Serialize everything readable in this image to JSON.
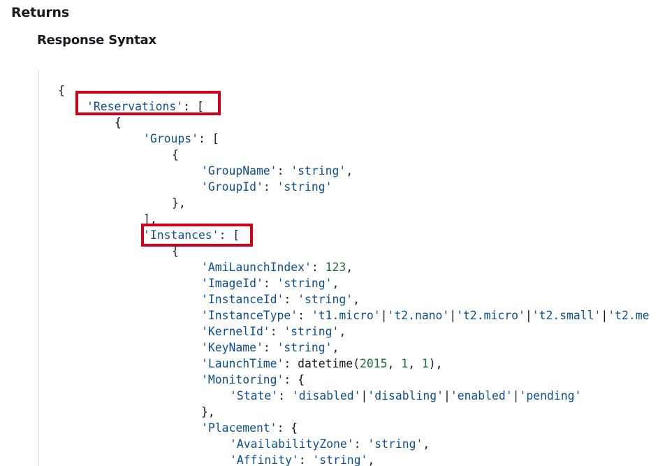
{
  "headings": {
    "returns": "Returns",
    "response_syntax": "Response Syntax"
  },
  "code_lines": [
    [
      {
        "t": "p",
        "v": "{"
      }
    ],
    [
      {
        "t": "s",
        "v": "'Reservations'"
      },
      {
        "t": "p",
        "v": ": ["
      }
    ],
    [
      {
        "t": "p",
        "v": "{"
      }
    ],
    [
      {
        "t": "s",
        "v": "'Groups'"
      },
      {
        "t": "p",
        "v": ": ["
      }
    ],
    [
      {
        "t": "p",
        "v": "{"
      }
    ],
    [
      {
        "t": "s",
        "v": "'GroupName'"
      },
      {
        "t": "p",
        "v": ": "
      },
      {
        "t": "s",
        "v": "'string'"
      },
      {
        "t": "p",
        "v": ","
      }
    ],
    [
      {
        "t": "s",
        "v": "'GroupId'"
      },
      {
        "t": "p",
        "v": ": "
      },
      {
        "t": "s",
        "v": "'string'"
      }
    ],
    [
      {
        "t": "p",
        "v": "},"
      }
    ],
    [
      {
        "t": "p",
        "v": "],"
      }
    ],
    [
      {
        "t": "s",
        "v": "'Instances'"
      },
      {
        "t": "p",
        "v": ": ["
      }
    ],
    [
      {
        "t": "p",
        "v": "{"
      }
    ],
    [
      {
        "t": "s",
        "v": "'AmiLaunchIndex'"
      },
      {
        "t": "p",
        "v": ": "
      },
      {
        "t": "n",
        "v": "123"
      },
      {
        "t": "p",
        "v": ","
      }
    ],
    [
      {
        "t": "s",
        "v": "'ImageId'"
      },
      {
        "t": "p",
        "v": ": "
      },
      {
        "t": "s",
        "v": "'string'"
      },
      {
        "t": "p",
        "v": ","
      }
    ],
    [
      {
        "t": "s",
        "v": "'InstanceId'"
      },
      {
        "t": "p",
        "v": ": "
      },
      {
        "t": "s",
        "v": "'string'"
      },
      {
        "t": "p",
        "v": ","
      }
    ],
    [
      {
        "t": "s",
        "v": "'InstanceType'"
      },
      {
        "t": "p",
        "v": ": "
      },
      {
        "t": "s",
        "v": "'t1.micro'"
      },
      {
        "t": "p",
        "v": "|"
      },
      {
        "t": "s",
        "v": "'t2.nano'"
      },
      {
        "t": "p",
        "v": "|"
      },
      {
        "t": "s",
        "v": "'t2.micro'"
      },
      {
        "t": "p",
        "v": "|"
      },
      {
        "t": "s",
        "v": "'t2.small'"
      },
      {
        "t": "p",
        "v": "|"
      },
      {
        "t": "s",
        "v": "'t2.me"
      }
    ],
    [
      {
        "t": "s",
        "v": "'KernelId'"
      },
      {
        "t": "p",
        "v": ": "
      },
      {
        "t": "s",
        "v": "'string'"
      },
      {
        "t": "p",
        "v": ","
      }
    ],
    [
      {
        "t": "s",
        "v": "'KeyName'"
      },
      {
        "t": "p",
        "v": ": "
      },
      {
        "t": "s",
        "v": "'string'"
      },
      {
        "t": "p",
        "v": ","
      }
    ],
    [
      {
        "t": "s",
        "v": "'LaunchTime'"
      },
      {
        "t": "p",
        "v": ": datetime("
      },
      {
        "t": "n",
        "v": "2015"
      },
      {
        "t": "p",
        "v": ", "
      },
      {
        "t": "n",
        "v": "1"
      },
      {
        "t": "p",
        "v": ", "
      },
      {
        "t": "n",
        "v": "1"
      },
      {
        "t": "p",
        "v": "),"
      }
    ],
    [
      {
        "t": "s",
        "v": "'Monitoring'"
      },
      {
        "t": "p",
        "v": ": {"
      }
    ],
    [
      {
        "t": "s",
        "v": "'State'"
      },
      {
        "t": "p",
        "v": ": "
      },
      {
        "t": "s",
        "v": "'disabled'"
      },
      {
        "t": "p",
        "v": "|"
      },
      {
        "t": "s",
        "v": "'disabling'"
      },
      {
        "t": "p",
        "v": "|"
      },
      {
        "t": "s",
        "v": "'enabled'"
      },
      {
        "t": "p",
        "v": "|"
      },
      {
        "t": "s",
        "v": "'pending'"
      }
    ],
    [
      {
        "t": "p",
        "v": "},"
      }
    ],
    [
      {
        "t": "s",
        "v": "'Placement'"
      },
      {
        "t": "p",
        "v": ": {"
      }
    ],
    [
      {
        "t": "s",
        "v": "'AvailabilityZone'"
      },
      {
        "t": "p",
        "v": ": "
      },
      {
        "t": "s",
        "v": "'string'"
      },
      {
        "t": "p",
        "v": ","
      }
    ],
    [
      {
        "t": "s",
        "v": "'Affinity'"
      },
      {
        "t": "p",
        "v": ": "
      },
      {
        "t": "s",
        "v": "'string'"
      },
      {
        "t": "p",
        "v": ","
      }
    ]
  ],
  "colors": {
    "string": "#0b4f94",
    "number": "#1a6b3a",
    "highlight": "#d0021b"
  }
}
